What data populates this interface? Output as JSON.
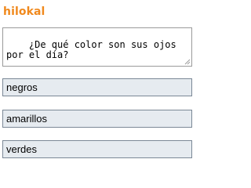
{
  "brand": {
    "logo_text": "hilokal",
    "color": "#f0891d"
  },
  "question": {
    "value": "¿De qué color son sus ojos por el día?"
  },
  "answers": [
    {
      "label": "negros"
    },
    {
      "label": "amarillos"
    },
    {
      "label": "verdes"
    }
  ],
  "colors": {
    "answer_background": "#e6ebf0",
    "answer_border": "#7b8896",
    "textarea_border": "#9a9a9a"
  }
}
